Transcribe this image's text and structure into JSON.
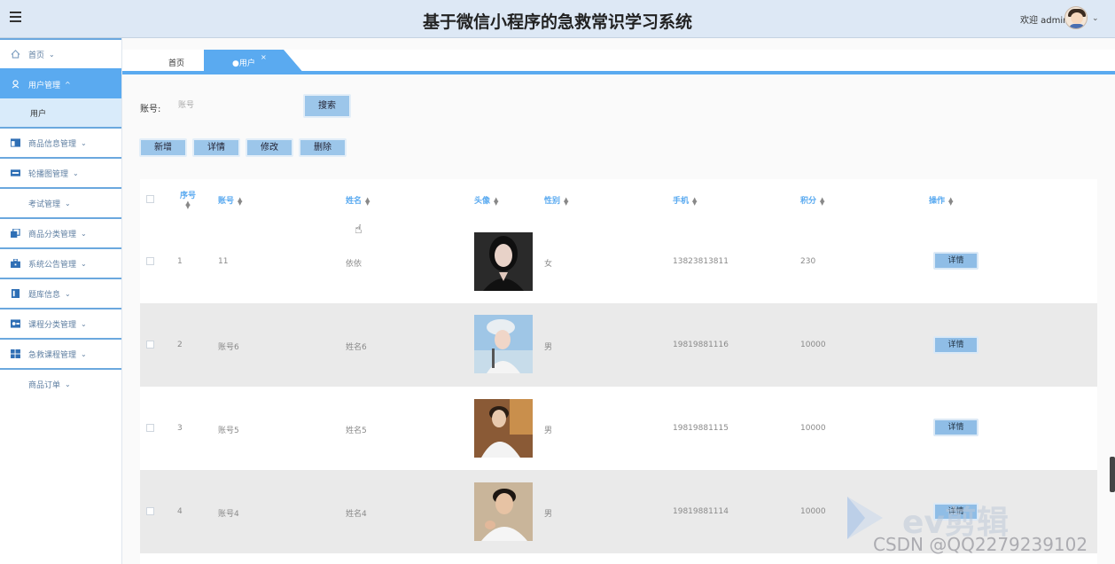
{
  "header": {
    "title": "基于微信小程序的急救常识学习系统",
    "welcome": "欢迎 admin"
  },
  "sidebar": {
    "items": [
      {
        "label": "首页",
        "icon": "home-icon"
      },
      {
        "label": "用户管理",
        "icon": "user-icon"
      },
      {
        "label": "用户"
      },
      {
        "label": "商品信息管理",
        "icon": "table-icon"
      },
      {
        "label": "轮播图管理",
        "icon": "carousel-icon"
      },
      {
        "label": "考试管理"
      },
      {
        "label": "商品分类管理",
        "icon": "copy-icon"
      },
      {
        "label": "系统公告管理",
        "icon": "briefcase-icon"
      },
      {
        "label": "题库信息",
        "icon": "book-icon"
      },
      {
        "label": "课程分类管理",
        "icon": "card-icon"
      },
      {
        "label": "急救课程管理",
        "icon": "grid-icon"
      },
      {
        "label": "商品订单"
      }
    ]
  },
  "tabs": {
    "home": "首页",
    "user": "●用户",
    "close": "×"
  },
  "search": {
    "label": "账号:",
    "placeholder": "账号",
    "button": "搜索"
  },
  "actions": {
    "add": "新增",
    "detail": "详情",
    "edit": "修改",
    "delete": "删除"
  },
  "table": {
    "columns": [
      "序号",
      "账号",
      "姓名",
      "头像",
      "性别",
      "手机",
      "积分",
      "操作"
    ],
    "rows": [
      {
        "no": "1",
        "account": "11",
        "name": "依依",
        "gender": "女",
        "phone": "13823813811",
        "points": "230",
        "action": "详情"
      },
      {
        "no": "2",
        "account": "账号6",
        "name": "姓名6",
        "gender": "男",
        "phone": "19819881116",
        "points": "10000",
        "action": "详情"
      },
      {
        "no": "3",
        "account": "账号5",
        "name": "姓名5",
        "gender": "男",
        "phone": "19819881115",
        "points": "10000",
        "action": "详情"
      },
      {
        "no": "4",
        "account": "账号4",
        "name": "姓名4",
        "gender": "男",
        "phone": "19819881114",
        "points": "10000",
        "action": "详情"
      }
    ]
  },
  "watermark": {
    "brand": "ev剪辑",
    "credit": "CSDN @QQ2279239102"
  },
  "colors": {
    "accent": "#5aaaf0",
    "header_bg": "#dde8f5",
    "button": "#9cc6ea"
  }
}
